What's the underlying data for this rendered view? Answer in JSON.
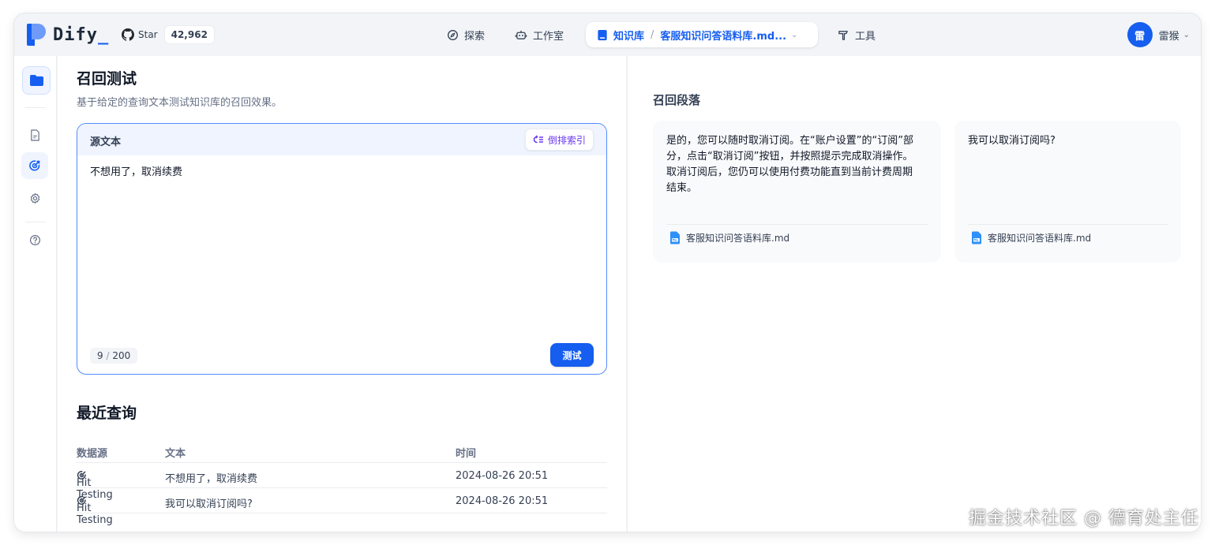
{
  "app": {
    "name": "Dify",
    "cursor": "_"
  },
  "github": {
    "label": "Star",
    "count": "42,962"
  },
  "nav": {
    "explore": "探索",
    "studio": "工作室",
    "knowledge": "知识库",
    "dataset": "客服知识问答语料库.md...",
    "tools": "工具"
  },
  "user": {
    "avatar_letter": "雷",
    "name": "雷猴"
  },
  "hit_testing": {
    "title": "召回测试",
    "description": "基于给定的查询文本测试知识库的召回效果。",
    "source_label": "源文本",
    "retrieval_method": "倒排索引",
    "query": "不想用了，取消续费",
    "char_count": "9",
    "char_limit": "200",
    "test_button": "测试"
  },
  "recent": {
    "title": "最近查询",
    "columns": [
      "数据源",
      "文本",
      "时间"
    ],
    "rows": [
      {
        "source": "Hit Testing",
        "text": "不想用了，取消续费",
        "time": "2024-08-26 20:51"
      },
      {
        "source": "Hit Testing",
        "text": "我可以取消订阅吗?",
        "time": "2024-08-26 20:51"
      }
    ]
  },
  "results": {
    "title": "召回段落",
    "cards": [
      {
        "content": "是的，您可以随时取消订阅。在“账户设置”的“订阅”部分，点击“取消订阅”按钮，并按照提示完成取消操作。取消订阅后，您仍可以使用付费功能直到当前计费周期结束。",
        "document": "客服知识问答语料库.md"
      },
      {
        "content": "我可以取消订阅吗?",
        "document": "客服知识问答语料库.md"
      }
    ]
  },
  "watermark": "掘金技术社区 @ 德育处主任",
  "colors": {
    "primary": "#155eef",
    "rerank": "#6938ef",
    "border_focus": "#528bff"
  }
}
